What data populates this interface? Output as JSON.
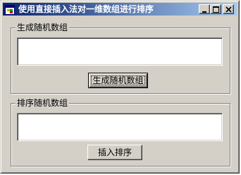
{
  "window": {
    "title": "使用直接插入法对一维数组进行排序",
    "icon": "app-window-icon",
    "controls": {
      "minimize": "minimize-icon",
      "maximize": "maximize-icon",
      "close": "close-icon"
    }
  },
  "generate_group": {
    "label": "生成随机数组",
    "text_value": "",
    "button_label": "生成随机数组"
  },
  "sort_group": {
    "label": "排序随机数组",
    "text_value": "",
    "button_label": "插入排序"
  },
  "colors": {
    "face": "#d4d0c8",
    "title_start": "#0a246a",
    "title_end": "#a6caf0"
  }
}
